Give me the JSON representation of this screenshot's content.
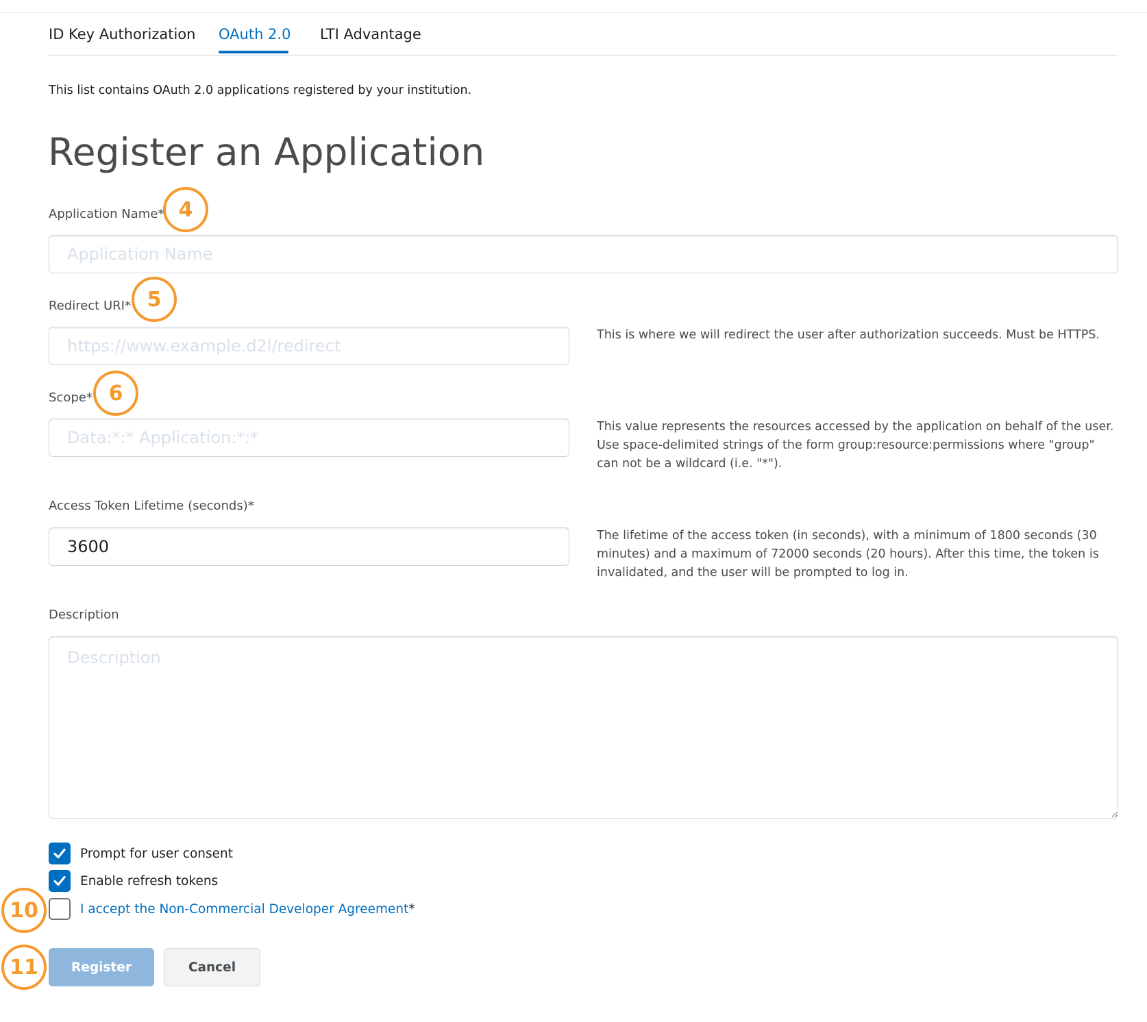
{
  "tabs": [
    {
      "label": "ID Key Authorization"
    },
    {
      "label": "OAuth 2.0"
    },
    {
      "label": "LTI Advantage"
    }
  ],
  "intro_text": "This list contains OAuth 2.0 applications registered by your institution.",
  "page_title": "Register an Application",
  "form": {
    "app_name": {
      "label": "Application Name",
      "required_mark": "*",
      "placeholder": "Application Name",
      "value": ""
    },
    "redirect_uri": {
      "label": "Redirect URI",
      "required_mark": "*",
      "placeholder": "https://www.example.d2l/redirect",
      "value": "",
      "help": "This is where we will redirect the user after authorization succeeds. Must be HTTPS."
    },
    "scope": {
      "label": "Scope",
      "required_mark": "*",
      "placeholder": "Data:*:* Application:*:*",
      "value": "",
      "help": "This value represents the resources accessed by the application on behalf of the user. Use space-delimited strings of the form group:resource:permissions where \"group\" can not be a wildcard (i.e. \"*\")."
    },
    "token_lifetime": {
      "label": "Access Token Lifetime (seconds)",
      "required_mark": "*",
      "value": "3600",
      "help": "The lifetime of the access token (in seconds), with a minimum of 1800 seconds (30 minutes) and a maximum of 72000 seconds (20 hours). After this time, the token is invalidated, and the user will be prompted to log in."
    },
    "description": {
      "label": "Description",
      "placeholder": "Description",
      "value": ""
    }
  },
  "checkboxes": {
    "user_consent": {
      "label": "Prompt for user consent",
      "checked": true
    },
    "refresh_tokens": {
      "label": "Enable refresh tokens",
      "checked": true
    },
    "agreement": {
      "label": "I accept the Non-Commercial Developer Agreement",
      "required_mark": "*",
      "checked": false
    }
  },
  "buttons": {
    "register": "Register",
    "cancel": "Cancel"
  },
  "callouts": {
    "app_name": "4",
    "redirect_uri": "5",
    "scope": "6",
    "agreement": "10",
    "register": "11"
  },
  "colors": {
    "accent": "#006fbf",
    "callout": "#f59a2f",
    "primary_disabled": "#8fb7dd"
  }
}
